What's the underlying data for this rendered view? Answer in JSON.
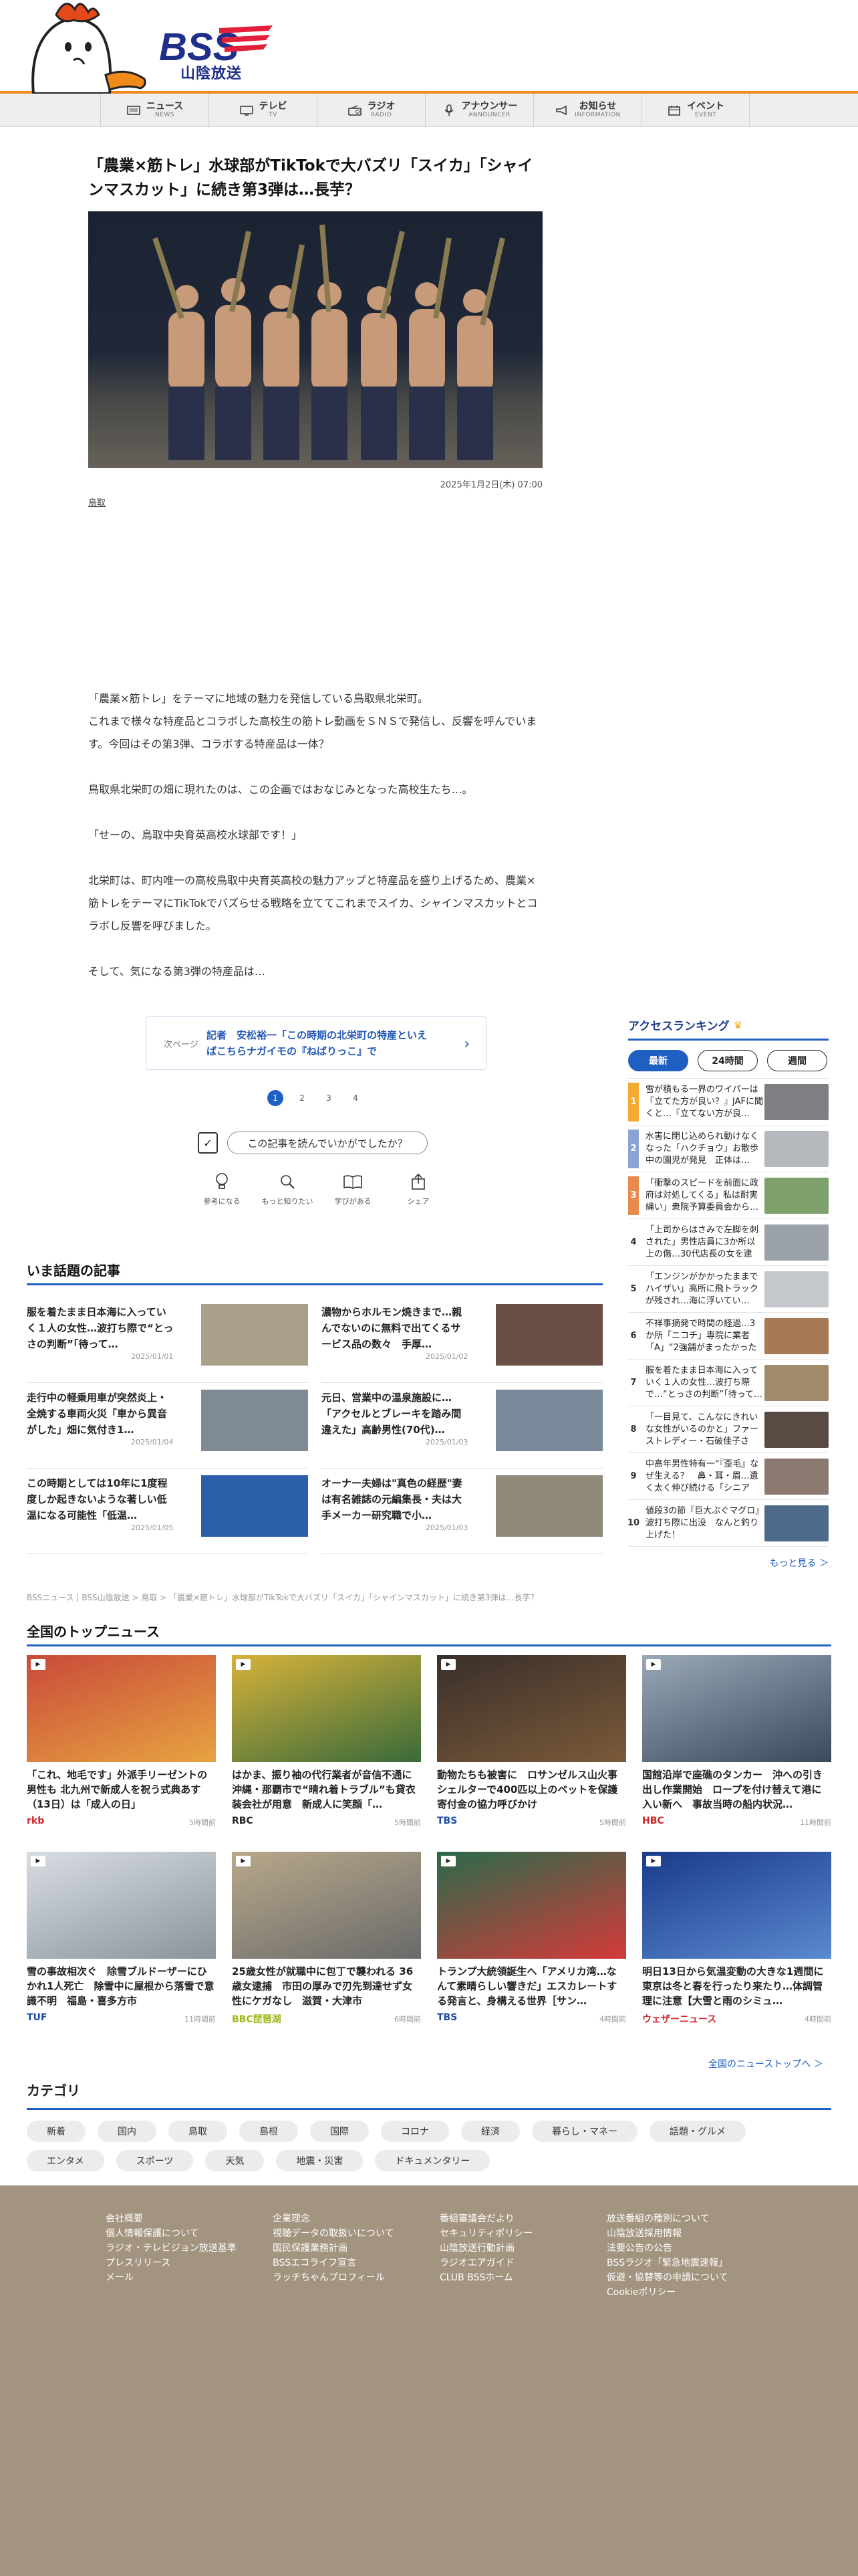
{
  "brand": {
    "logo_text": "BSS",
    "sub": "山陰放送"
  },
  "nav": [
    {
      "ja": "ニュース",
      "en": "NEWS",
      "icon": "newspaper-icon"
    },
    {
      "ja": "テレビ",
      "en": "TV",
      "icon": "tv-icon"
    },
    {
      "ja": "ラジオ",
      "en": "RADIO",
      "icon": "radio-icon"
    },
    {
      "ja": "アナウンサー",
      "en": "ANNOUNCER",
      "icon": "microphone-icon"
    },
    {
      "ja": "お知らせ",
      "en": "INFORMATION",
      "icon": "megaphone-icon"
    },
    {
      "ja": "イベント",
      "en": "EVENT",
      "icon": "calendar-icon"
    }
  ],
  "article": {
    "title": "「農業×筋トレ」水球部がTikTokで大バズリ「スイカ」「シャインマスカット」に続き第3弾は…長芋？",
    "date": "2025年1月2日(木) 07:00",
    "tag": "鳥取",
    "paragraphs": [
      "「農業×筋トレ」をテーマに地域の魅力を発信している鳥取県北栄町。\nこれまで様々な特産品とコラボした高校生の筋トレ動画をＳＮＳで発信し、反響を呼んでいます。今回はその第3弾、コラボする特産品は一体？",
      "鳥取県北栄町の畑に現れたのは、この企画ではおなじみとなった高校生たち…。",
      "「せーの、鳥取中央育英高校水球部です！」",
      "北栄町は、町内唯一の高校鳥取中央育英高校の魅力アップと特産品を盛り上げるため、農業×筋トレをテーマにTikTokでバズらせる戦略を立ててこれまでスイカ、シャインマスカットとコラボし反響を呼びました。",
      "そして、気になる第3弾の特産品は…"
    ]
  },
  "next": {
    "label": "次ページ",
    "text": "記者　安松裕一「この時期の北栄町の特産といえばこちらナガイモの『ねばりっこ』で"
  },
  "pages": [
    "1",
    "2",
    "3",
    "4"
  ],
  "rate": {
    "question": "この記事を読んでいかがでしたか？"
  },
  "reactions": [
    {
      "label": "参考になる",
      "icon": "lightbulb-icon"
    },
    {
      "label": "もっと知りたい",
      "icon": "magnifier-icon"
    },
    {
      "label": "学びがある",
      "icon": "book-icon"
    },
    {
      "label": "シェア",
      "icon": "share-icon"
    }
  ],
  "ranking": {
    "title": "アクセスランキング",
    "tabs": [
      "最新",
      "24時間",
      "週間"
    ],
    "items": [
      {
        "no": "1",
        "text": "雪が積もる一界のワイパーは『立てた方が良い？』JAFに聞くと…『立てない方が良…",
        "color": "#7d7f83"
      },
      {
        "no": "2",
        "text": "水害に閉じ込められ動けなくなった「ハクチョウ」お散歩中の園児が発見　正体は…",
        "color": "#b5b9bd"
      },
      {
        "no": "3",
        "text": "「衝撃のスピードを前面に政府は対処してくる」私は耐実縄い」衆院予算委員会から…",
        "color": "#7ea06a"
      },
      {
        "no": "4",
        "text": "「上司からはさみで左脚を刺された」男性店員に3か所以上の傷…30代店長の女を逮捕…",
        "color": "#9aa1a8"
      },
      {
        "no": "5",
        "text": "「エンジンがかかったままでハイザい」高所に飛トラックが残され…海に浮いてい…",
        "color": "#c4c8cc"
      },
      {
        "no": "6",
        "text": "不祥事摘発で時間の経過…3か所「ニコチ」専院に業者「A」“2強舗がまったかったので…",
        "color": "#a67a55"
      },
      {
        "no": "7",
        "text": "服を着たまま日本海に入っていく１人の女性…波打ち際で…“とっさの判断”「待って…",
        "color": "#a08a6a"
      },
      {
        "no": "8",
        "text": "「一目見て、こんなにきれいな女性がいるのかと」ファーストレディー・石破佳子さん…",
        "color": "#5a4a44"
      },
      {
        "no": "9",
        "text": "中高年男性特有一“『歪毛』なぜ生える？　鼻・耳・眉…遺く太く伸び続ける「シニア毛…",
        "color": "#8c7a70"
      },
      {
        "no": "10",
        "text": "値段3の節『巨大ぷぐマグロ』波打ち際に出没　なんと釣り上げた！",
        "color": "#4e6a8a"
      }
    ],
    "more": "もっと見る ＞"
  },
  "trending": {
    "title": "いま話題の記事",
    "items": [
      {
        "text": "服を着たまま日本海に入っていく１人の女性…波打ち際で“とっさの判断”「待って…",
        "date": "2025/01/01",
        "color": "#a8a089"
      },
      {
        "text": "濃物からホルモン焼きまで…親んでないのに無料で出てくるサービス品の数々　手厚…",
        "date": "2025/01/02",
        "color": "#6b4f44"
      },
      {
        "text": "走行中の軽乗用車が突然炎上・全焼する車両火災「車から異音がした」畑に気付き1…",
        "date": "2025/01/04",
        "color": "#7e8a96"
      },
      {
        "text": "元日、営業中の温泉施設に…「アクセルとブレーキを踏み間違えた」高齢男性(70代)…",
        "date": "2025/01/03",
        "color": "#7a8a9a"
      },
      {
        "text": "この時期としては10年に1度程度しか起きないような著しい低温になる可能性「低温…",
        "date": "2025/01/05",
        "color": "#2b5fa8"
      },
      {
        "text": "オーナー夫婦は\"真色の経歴\"妻は有名雑誌の元編集長・夫は大手メーカー研究職で小…",
        "date": "2025/01/03",
        "color": "#8f8a79"
      }
    ]
  },
  "breadcrumb": "BSSニュース | BSS山陰放送 > 鳥取 > 「農業×筋トレ」水球部がTikTokで大バズリ「スイカ」「シャインマスカット」に続き第3弾は…長芋？",
  "national": {
    "title": "全国のトップニュース",
    "items": [
      {
        "title": "「これ、地毛です」外派手リーゼントの男性も 北九州で新成人を祝う式典あす（13日）は「成人の日」",
        "src": "rkb",
        "src_color": "#d2232a",
        "time": "5時間前",
        "c1": "#c94a3a",
        "c2": "#e7a341"
      },
      {
        "title": "はかま、振り袖の代行業者が音信不通に 沖縄・那覇市で“晴れ着トラブル”も貸衣装会社が用意　新成人に笑顔「…",
        "src": "RBC",
        "src_color": "#222222",
        "time": "5時間前",
        "c1": "#d6b23a",
        "c2": "#3a6a3a"
      },
      {
        "title": "動物たちも被害に　ロサンゼルス山火事 シェルターで400匹以上のペットを保護　寄付金の協力呼びかけ",
        "src": "TBS",
        "src_color": "#1a4aa0",
        "time": "5時間前",
        "c1": "#3a2f2a",
        "c2": "#7a5a3a"
      },
      {
        "title": "国館沿岸で座礁のタンカー　沖への引き出し作業開始　ロープを付け替えて港に入い新へ　事故当時の船内状況…",
        "src": "HBC",
        "src_color": "#d2232a",
        "time": "11時間前",
        "c1": "#9aa8b8",
        "c2": "#3a4a5a"
      },
      {
        "title": "雪の事故相次ぐ　除雪ブルドーザーにひかれ1人死亡　除雪中に屋根から落雪で意識不明　福島・喜多方市",
        "src": "TUF",
        "src_color": "#1a4aa0",
        "time": "11時間前",
        "c1": "#d8dde2",
        "c2": "#8a949c"
      },
      {
        "title": "25歳女性が就職中に包丁で襲われる 36歳女逮捕　市田の厚みで刃先到達せず女性にケガなし　滋賀・大津市",
        "src": "BBC琵琶湖",
        "src_color": "#a0b81a",
        "time": "6時間前",
        "c1": "#b8a88a",
        "c2": "#6a6a6a"
      },
      {
        "title": "トランプ大統領誕生へ「アメリカ湾…なんて素晴らしい響きだ」エスカレートする発言と、身構える世界［サン…",
        "src": "TBS",
        "src_color": "#1a4aa0",
        "time": "4時間前",
        "c1": "#2a6a4a",
        "c2": "#d43a3a"
      },
      {
        "title": "明日13日から気温変動の大きな1週間に　東京は冬と春を行ったり来たり…体調管理に注意【大雪と雨のシミュ…",
        "src": "ウェザーニュース",
        "src_color": "#d2232a",
        "time": "4時間前",
        "c1": "#1a3a8a",
        "c2": "#5a8ad0"
      }
    ],
    "more": "全国のニューストップへ ＞"
  },
  "categories": {
    "title": "カテゴリ",
    "items": [
      "新着",
      "国内",
      "鳥取",
      "島根",
      "国際",
      "コロナ",
      "経済",
      "暮らし・マネー",
      "話題・グルメ",
      "エンタメ",
      "スポーツ",
      "天気",
      "地震・災害",
      "ドキュメンタリー"
    ]
  },
  "footer": [
    [
      "会社概要",
      "個人情報保護について",
      "ラジオ・テレビジョン放送基準",
      "プレスリリース",
      "メール"
    ],
    [
      "企業理念",
      "視聴データの取扱いについて",
      "国民保護業務計画",
      "BSSエコライフ宣言",
      "ラッチちゃんプロフィール"
    ],
    [
      "番組審議会だより",
      "セキュリティポリシー",
      "山陰放送行動計画",
      "ラジオエアガイド",
      "CLUB BSSホーム"
    ],
    [
      "放送番組の種別について",
      "山陰放送採用情報",
      "法要公告の公告",
      "BSSラジオ「緊急地震速報」",
      "仮避・協替等の申請について",
      "Cookieポリシー"
    ]
  ]
}
